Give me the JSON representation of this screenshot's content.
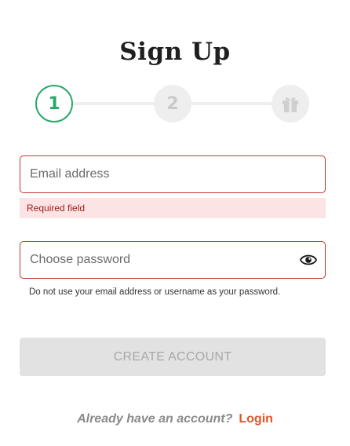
{
  "page": {
    "title": "Sign Up"
  },
  "stepper": {
    "steps": [
      {
        "label": "1",
        "state": "active"
      },
      {
        "label": "2",
        "state": "inactive"
      },
      {
        "icon": "gift-icon",
        "state": "inactive"
      }
    ],
    "active_color": "#2aa86b",
    "inactive_color": "#eeeeee"
  },
  "form": {
    "email": {
      "placeholder": "Email address",
      "value": "",
      "error": "Required field"
    },
    "password": {
      "placeholder": "Choose password",
      "value": "",
      "toggle_icon": "eye-icon",
      "hint": "Do not use your email address or username as your password."
    },
    "submit_label": "CREATE ACCOUNT"
  },
  "footer": {
    "question": "Already have an account?",
    "login_label": "Login",
    "link_color": "#e0572c"
  },
  "colors": {
    "error_border": "#c0392b",
    "error_bg": "#fde4e4",
    "error_text": "#a11d1d"
  }
}
